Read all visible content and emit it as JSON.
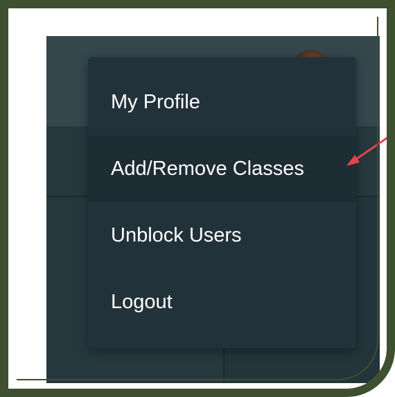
{
  "menu": {
    "items": [
      {
        "label": "My Profile"
      },
      {
        "label": "Add/Remove Classes"
      },
      {
        "label": "Unblock Users"
      },
      {
        "label": "Logout"
      }
    ]
  },
  "colors": {
    "frame": "#3e5030",
    "menu_background": "#22323a",
    "header_background": "#33474d",
    "annotation_arrow": "#e8424c"
  },
  "annotation": {
    "icon": "red-arrow-icon"
  }
}
